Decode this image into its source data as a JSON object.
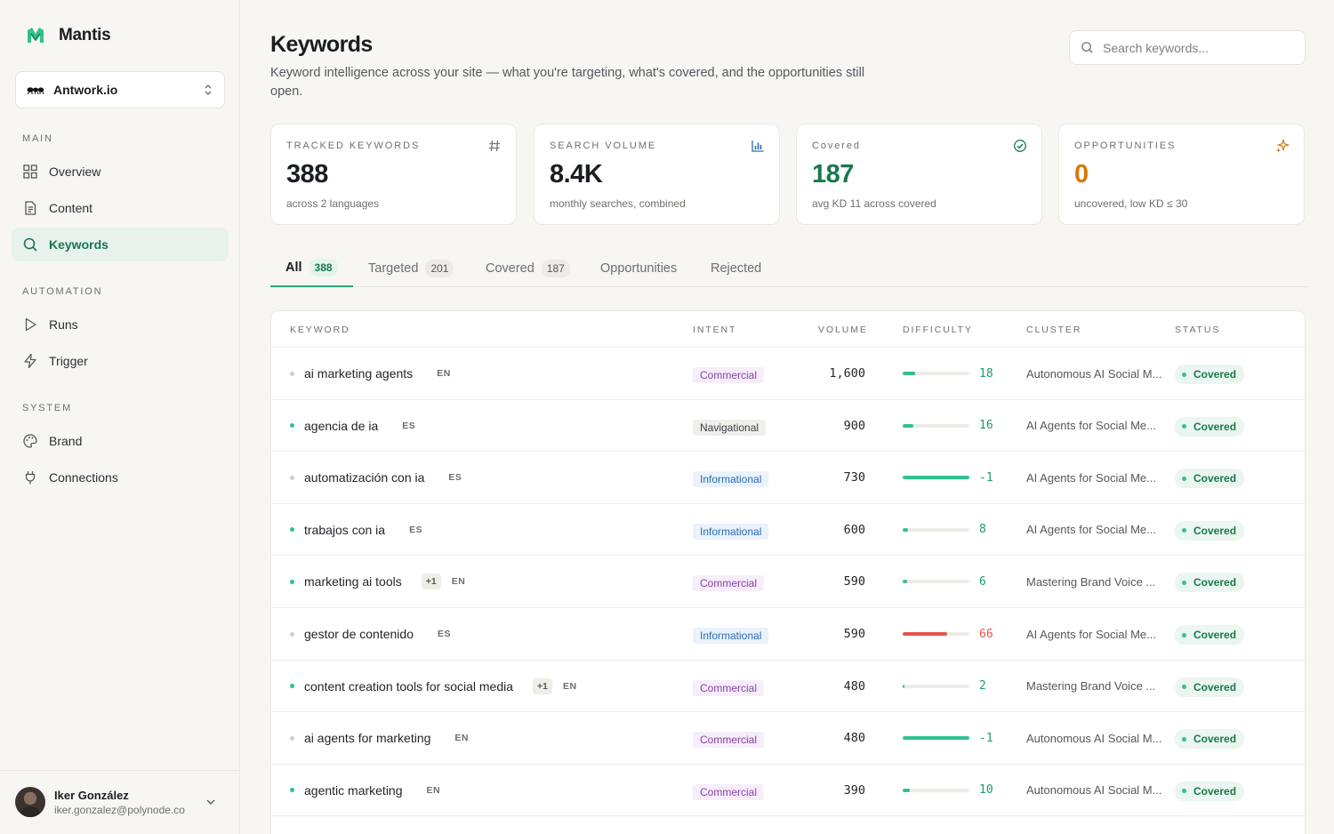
{
  "app": {
    "name": "Mantis",
    "workspace": "Antwork.io"
  },
  "sidebar": {
    "sections": [
      {
        "title": "MAIN",
        "items": [
          {
            "label": "Overview",
            "icon": "grid-icon",
            "active": false
          },
          {
            "label": "Content",
            "icon": "document-icon",
            "active": false
          },
          {
            "label": "Keywords",
            "icon": "search-icon",
            "active": true
          }
        ]
      },
      {
        "title": "AUTOMATION",
        "items": [
          {
            "label": "Runs",
            "icon": "play-icon",
            "active": false
          },
          {
            "label": "Trigger",
            "icon": "bolt-icon",
            "active": false
          }
        ]
      },
      {
        "title": "SYSTEM",
        "items": [
          {
            "label": "Brand",
            "icon": "palette-icon",
            "active": false
          },
          {
            "label": "Connections",
            "icon": "plug-icon",
            "active": false
          }
        ]
      }
    ]
  },
  "user": {
    "name": "Iker González",
    "email": "iker.gonzalez@polynode.co"
  },
  "page": {
    "title": "Keywords",
    "subtitle": "Keyword intelligence across your site — what you're targeting, what's covered, and the opportunities still open.",
    "search_placeholder": "Search keywords..."
  },
  "stats": [
    {
      "label": "TRACKED KEYWORDS",
      "value": "388",
      "note": "across 2 languages",
      "icon": "hash-icon",
      "color": "#1a1d21"
    },
    {
      "label": "SEARCH VOLUME",
      "value": "8.4K",
      "note": "monthly searches, combined",
      "icon": "bar-chart-icon",
      "color": "#1a1d21"
    },
    {
      "label": "Covered",
      "value": "187",
      "note": "avg KD 11 across covered",
      "icon": "check-circle-icon",
      "color": "#18794e"
    },
    {
      "label": "OPPORTUNITIES",
      "value": "0",
      "note": "uncovered, low KD ≤ 30",
      "icon": "sparkles-icon",
      "color": "#d97706"
    }
  ],
  "tabs": [
    {
      "label": "All",
      "count": "388",
      "active": true
    },
    {
      "label": "Targeted",
      "count": "201",
      "active": false
    },
    {
      "label": "Covered",
      "count": "187",
      "active": false
    },
    {
      "label": "Opportunities",
      "count": "",
      "active": false
    },
    {
      "label": "Rejected",
      "count": "",
      "active": false
    }
  ],
  "table": {
    "columns": [
      "KEYWORD",
      "INTENT",
      "VOLUME",
      "DIFFICULTY",
      "CLUSTER",
      "STATUS"
    ],
    "rows": [
      {
        "keyword": "ai marketing agents",
        "extra": "",
        "lang": "EN",
        "dot": false,
        "intent": "Commercial",
        "volume": "1,600",
        "kd": "18",
        "kd_value": 18,
        "cluster": "Autonomous AI Social M...",
        "status": "Covered"
      },
      {
        "keyword": "agencia de ia",
        "extra": "",
        "lang": "ES",
        "dot": true,
        "intent": "Navigational",
        "volume": "900",
        "kd": "16",
        "kd_value": 16,
        "cluster": "AI Agents for Social Me...",
        "status": "Covered"
      },
      {
        "keyword": "automatización con ia",
        "extra": "",
        "lang": "ES",
        "dot": false,
        "intent": "Informational",
        "volume": "730",
        "kd": "-1",
        "kd_value": 100,
        "cluster": "AI Agents for Social Me...",
        "status": "Covered"
      },
      {
        "keyword": "trabajos con ia",
        "extra": "",
        "lang": "ES",
        "dot": true,
        "intent": "Informational",
        "volume": "600",
        "kd": "8",
        "kd_value": 8,
        "cluster": "AI Agents for Social Me...",
        "status": "Covered"
      },
      {
        "keyword": "marketing ai tools",
        "extra": "+1",
        "lang": "EN",
        "dot": true,
        "intent": "Commercial",
        "volume": "590",
        "kd": "6",
        "kd_value": 6,
        "cluster": "Mastering Brand Voice ...",
        "status": "Covered"
      },
      {
        "keyword": "gestor de contenido",
        "extra": "",
        "lang": "ES",
        "dot": false,
        "intent": "Informational",
        "volume": "590",
        "kd": "66",
        "kd_value": 66,
        "cluster": "AI Agents for Social Me...",
        "status": "Covered"
      },
      {
        "keyword": "content creation tools for social media",
        "extra": "+1",
        "lang": "EN",
        "dot": true,
        "intent": "Commercial",
        "volume": "480",
        "kd": "2",
        "kd_value": 2,
        "cluster": "Mastering Brand Voice ...",
        "status": "Covered"
      },
      {
        "keyword": "ai agents for marketing",
        "extra": "",
        "lang": "EN",
        "dot": false,
        "intent": "Commercial",
        "volume": "480",
        "kd": "-1",
        "kd_value": 100,
        "cluster": "Autonomous AI Social M...",
        "status": "Covered"
      },
      {
        "keyword": "agentic marketing",
        "extra": "",
        "lang": "EN",
        "dot": true,
        "intent": "Commercial",
        "volume": "390",
        "kd": "10",
        "kd_value": 10,
        "cluster": "Autonomous AI Social M...",
        "status": "Covered"
      }
    ]
  },
  "colors": {
    "accent": "#18794e",
    "kd_low": "#2fc28c",
    "kd_high": "#e5534b"
  }
}
